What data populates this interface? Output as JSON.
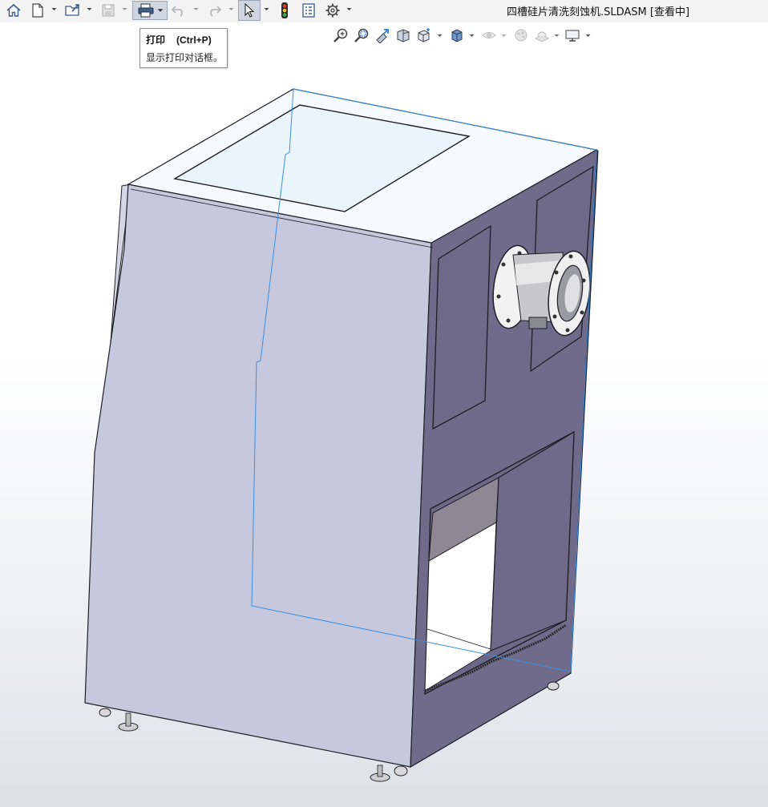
{
  "window": {
    "title": "四槽硅片清洗刻蚀机.SLDASM [查看中]"
  },
  "toolbar": {
    "items": [
      "home-icon",
      "new-document-icon",
      "open-file-icon",
      "save-icon",
      "print-icon",
      "undo-icon",
      "redo-icon",
      "select-icon",
      "rebuild-traffic-light-icon",
      "file-properties-icon",
      "options-gear-icon"
    ]
  },
  "tooltip": {
    "title": "打印",
    "shortcut": "(Ctrl+P)",
    "description": "显示打印对话框。"
  },
  "headsup_toolbar": {
    "items": [
      "zoom-to-fit-icon",
      "zoom-to-area-icon",
      "previous-view-icon",
      "section-view-icon",
      "view-orientation-icon",
      "display-style-icon",
      "hide-show-items-icon",
      "edit-appearance-icon",
      "apply-scene-icon",
      "view-settings-icon"
    ]
  },
  "colors": {
    "panel_left": "#c6c9de",
    "panel_right": "#706b8a",
    "panel_top": "#f4fafd",
    "outline": "#1e1e24",
    "selection": "#3b8de0",
    "toolbar_bg": "#f3f3f3"
  }
}
